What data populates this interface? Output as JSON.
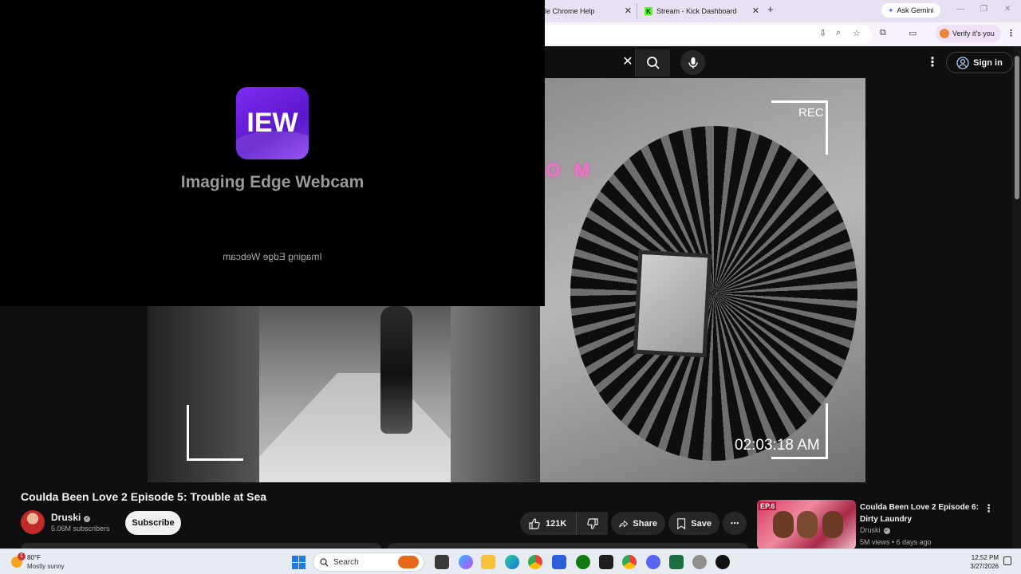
{
  "browser": {
    "tabs": [
      {
        "label": "le Chrome Help"
      },
      {
        "label": "Stream - Kick Dashboard",
        "icon": "kick-logo-icon"
      }
    ],
    "new_tab": "+",
    "gemini_label": "Ask Gemini",
    "verify_label": "Verify it's you",
    "colors": {
      "tabstrip": "#e8e0f3",
      "toolbar": "#f7f2fb"
    }
  },
  "youtube": {
    "signin_label": "Sign in",
    "video": {
      "rec_label": "REC",
      "timestamp": "02:03:18 AM",
      "neon_text": "O M"
    },
    "title": "Coulda Been Love 2 Episode 5: Trouble at Sea",
    "channel": {
      "name": "Druski",
      "subscribers": "5.06M subscribers"
    },
    "subscribe_label": "Subscribe",
    "actions": {
      "likes": "121K",
      "share": "Share",
      "save": "Save"
    },
    "recommendation": {
      "title": "Coulda Been Love 2 Episode 6: Dirty Laundry",
      "channel": "Druski",
      "meta": "5M views • 6 days ago",
      "thumb_badge": "EP.6"
    }
  },
  "webcam_overlay": {
    "logo_text": "IEW",
    "title": "Imaging Edge Webcam",
    "mirrored_text": "Imaging Edge Webcam"
  },
  "taskbar": {
    "weather": {
      "temp": "80°F",
      "condition": "Mostly sunny",
      "badge": "1"
    },
    "search_label": "Search",
    "time": "12:52 PM",
    "date": "3/27/2026"
  }
}
